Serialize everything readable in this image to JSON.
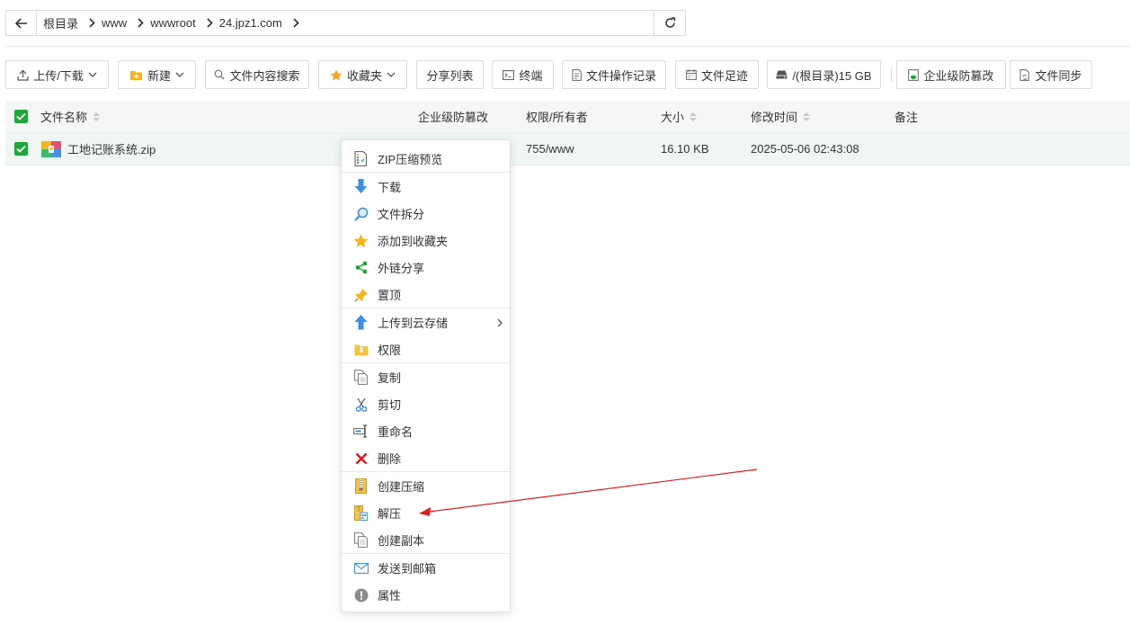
{
  "address": {
    "crumbs": [
      "根目录",
      "www",
      "wwwroot",
      "24.jpz1.com"
    ]
  },
  "toolbar": {
    "upload_download": "上传/下载",
    "new": "新建",
    "content_search": "文件内容搜索",
    "favorites": "收藏夹",
    "share_list": "分享列表",
    "terminal": "终端",
    "op_log": "文件操作记录",
    "footprint": "文件足迹",
    "disk": "/(根目录)15 GB",
    "tamper": "企业级防篡改",
    "sync": "文件同步"
  },
  "table": {
    "headers": {
      "name": "文件名称",
      "tamper": "企业级防篡改",
      "perm": "权限/所有者",
      "size": "大小",
      "mtime": "修改时间",
      "note": "备注"
    },
    "rows": [
      {
        "name": "工地记账系统.zip",
        "perm": "755/www",
        "size": "16.10 KB",
        "mtime": "2025-05-06 02:43:08"
      }
    ]
  },
  "context_menu": {
    "items": [
      {
        "label": "ZIP压缩预览",
        "icon": "zip-preview-icon"
      },
      {
        "label": "下载",
        "icon": "download-arrow-icon"
      },
      {
        "label": "文件拆分",
        "icon": "magnifier-icon"
      },
      {
        "label": "添加到收藏夹",
        "icon": "star-icon"
      },
      {
        "label": "外链分享",
        "icon": "share-icon"
      },
      {
        "label": "置顶",
        "icon": "pin-icon"
      },
      {
        "label": "上传到云存储",
        "icon": "upload-arrow-icon"
      },
      {
        "label": "权限",
        "icon": "folder-lock-icon"
      },
      {
        "label": "复制",
        "icon": "copy-icon"
      },
      {
        "label": "剪切",
        "icon": "scissors-icon"
      },
      {
        "label": "重命名",
        "icon": "rename-icon"
      },
      {
        "label": "删除",
        "icon": "delete-x-icon"
      },
      {
        "label": "创建压缩",
        "icon": "archive-icon"
      },
      {
        "label": "解压",
        "icon": "extract-icon"
      },
      {
        "label": "创建副本",
        "icon": "duplicate-icon"
      },
      {
        "label": "发送到邮箱",
        "icon": "mail-icon"
      },
      {
        "label": "属性",
        "icon": "info-icon"
      }
    ]
  },
  "colors": {
    "accent_green": "#20a53a",
    "annotation_red": "#e02020"
  }
}
